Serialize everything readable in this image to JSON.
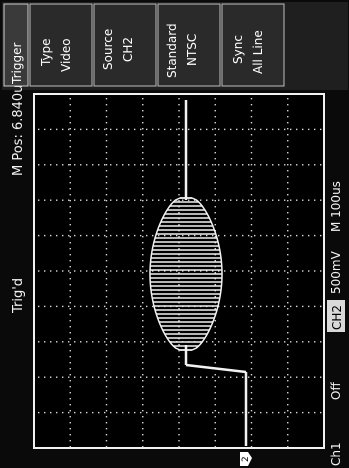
{
  "status": {
    "trigger_state": "Trig'd",
    "main_position": "M Pos: 6.840us"
  },
  "trigger_menu": {
    "title": "Trigger",
    "items": [
      {
        "label": "Type",
        "value": "Video"
      },
      {
        "label": "Source",
        "value": "CH2"
      },
      {
        "label": "Standard",
        "value": "NTSC"
      },
      {
        "label": "Sync",
        "value": "All Line"
      }
    ]
  },
  "bottom_bar": {
    "ch1_label": "Ch1",
    "ch1_value": "Off",
    "ch2_label": "CH2",
    "ch2_scale": "500mV",
    "timebase": "M 100us"
  },
  "markers": {
    "channel_marker": "2"
  },
  "colors": {
    "screen_bg": "#0a0a0a",
    "panel_bg": "#262626",
    "trace": "#f2f2f2",
    "grid": "#d9d9d9"
  }
}
